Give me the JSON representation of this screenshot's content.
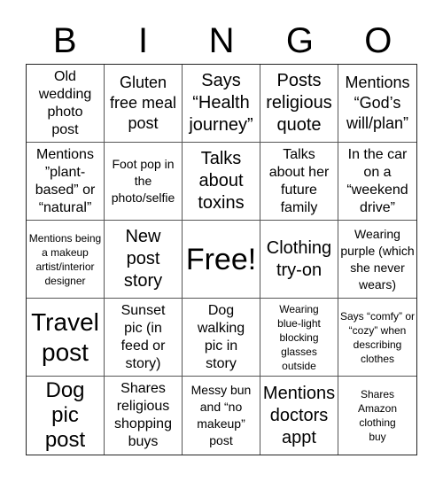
{
  "header": {
    "letters": [
      "B",
      "I",
      "N",
      "G",
      "O"
    ]
  },
  "cells": [
    "Old wedding photo post",
    "Gluten free meal post",
    "Says “Health journey”",
    "Posts religious quote",
    "Mentions “God’s will/plan”",
    "Mentions ”plant-based” or “natural”",
    "Foot pop in the photo/selfie",
    "Talks about toxins",
    "Talks about her future family",
    "In the car on a “weekend drive”",
    "Mentions being a makeup artist/interior designer",
    "New post story",
    "Free!",
    "Clothing try-on",
    "Wearing purple (which she never wears)",
    "Travel post",
    "Sunset pic (in feed or story)",
    "Dog walking pic in story",
    "Wearing blue-light blocking glasses outside",
    "Says “comfy” or “cozy” when describing clothes",
    "Dog pic post",
    "Shares religious shopping buys",
    "Messy bun and “no makeup” post",
    "Mentions doctors appt",
    "Shares Amazon clothing buy"
  ]
}
